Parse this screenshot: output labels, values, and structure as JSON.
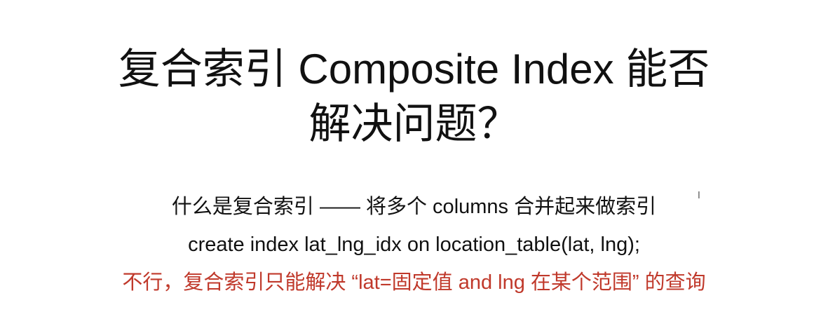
{
  "slide": {
    "title_line_1": "复合索引 Composite Index 能否",
    "title_line_2": "解决问题？",
    "line_1": "什么是复合索引 —— 将多个 columns 合并起来做索引",
    "line_2": "create index lat_lng_idx on location_table(lat, lng);",
    "line_3": "不行，复合索引只能解决 “lat=固定值 and lng 在某个范围” 的查询"
  },
  "colors": {
    "text": "#111111",
    "highlight": "#c0392b",
    "background": "#ffffff"
  },
  "icons": {
    "cursor": "text-cursor-icon"
  }
}
